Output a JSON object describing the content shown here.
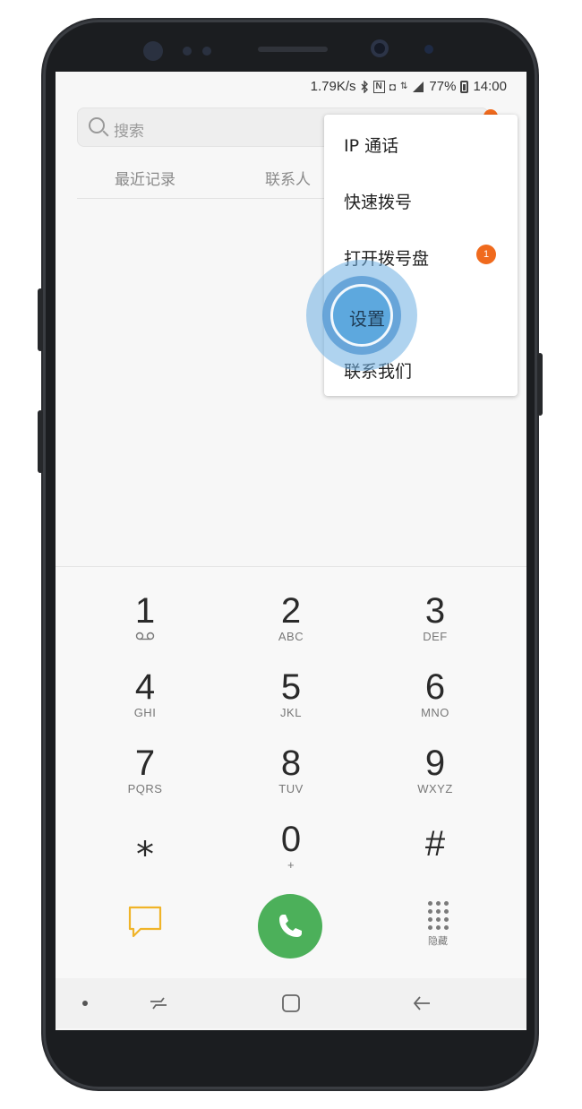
{
  "status_bar": {
    "speed": "1.79K/s",
    "battery_percent": "77%",
    "time": "14:00",
    "icons": [
      "bluetooth-icon",
      "nfc-icon",
      "data-icon",
      "signal-icon",
      "battery-icon"
    ]
  },
  "search": {
    "placeholder": "搜索"
  },
  "tabs": [
    {
      "label": "最近记录"
    },
    {
      "label": "联系人"
    }
  ],
  "menu": {
    "items": [
      {
        "label": "IP 通话"
      },
      {
        "label": "快速拨号"
      },
      {
        "label": "打开拨号盘",
        "badge": "1"
      },
      {
        "label": "设置"
      },
      {
        "label": "联系我们"
      }
    ]
  },
  "dialpad": {
    "keys": [
      {
        "num": "1",
        "letters": ""
      },
      {
        "num": "2",
        "letters": "ABC"
      },
      {
        "num": "3",
        "letters": "DEF"
      },
      {
        "num": "4",
        "letters": "GHI"
      },
      {
        "num": "5",
        "letters": "JKL"
      },
      {
        "num": "6",
        "letters": "MNO"
      },
      {
        "num": "7",
        "letters": "PQRS"
      },
      {
        "num": "8",
        "letters": "TUV"
      },
      {
        "num": "9",
        "letters": "WXYZ"
      },
      {
        "num": "⁎",
        "letters": ""
      },
      {
        "num": "0",
        "letters": "+"
      },
      {
        "num": "#",
        "letters": ""
      }
    ]
  },
  "actions": {
    "hide_label": "隐藏"
  },
  "colors": {
    "call_green": "#4cb05a",
    "badge_orange": "#f06a1d",
    "touch_blue": "#5da8de",
    "message_yellow": "#f0b429"
  }
}
